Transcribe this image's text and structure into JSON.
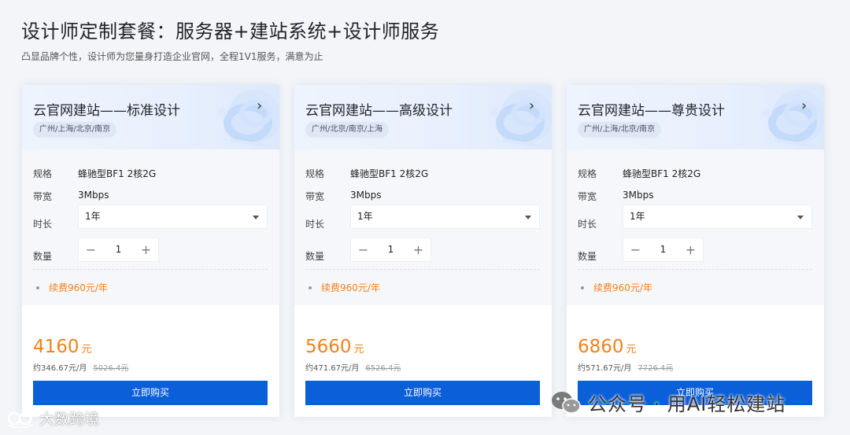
{
  "header": {
    "title": "设计师定制套餐：服务器+建站系统+设计师服务",
    "subtitle": "凸显品牌个性，设计师为您量身打造企业官网，全程1V1服务，满意为止"
  },
  "labels": {
    "spec": "规格",
    "bandwidth": "带宽",
    "duration": "时长",
    "quantity": "数量",
    "minus": "−",
    "plus": "+",
    "price_unit": "元",
    "buy": "立即购买"
  },
  "cards": [
    {
      "title": "云官网建站——标准设计",
      "regions": "广州/上海/北京/南京",
      "spec": "蜂驰型BF1 2核2G",
      "bandwidth": "3Mbps",
      "duration": "1年",
      "quantity": "1",
      "renew": "续费960元/年",
      "price": "4160",
      "monthly": "约346.67元/月",
      "original": "5026.4元"
    },
    {
      "title": "云官网建站——高级设计",
      "regions": "广州/北京/南京/上海",
      "spec": "蜂驰型BF1 2核2G",
      "bandwidth": "3Mbps",
      "duration": "1年",
      "quantity": "1",
      "renew": "续费960元/年",
      "price": "5660",
      "monthly": "约471.67元/月",
      "original": "6526.4元"
    },
    {
      "title": "云官网建站——尊贵设计",
      "regions": "广州/上海/北京/南京",
      "spec": "蜂驰型BF1 2核2G",
      "bandwidth": "3Mbps",
      "duration": "1年",
      "quantity": "1",
      "renew": "续费960元/年",
      "price": "6860",
      "monthly": "约571.67元/月",
      "original": "7726.4元"
    }
  ],
  "watermarks": {
    "left": "大数跨境",
    "right": "公众号 · 用AI轻松建站"
  },
  "icons": {
    "chevron": "chevron-right-icon",
    "caret": "caret-down-icon",
    "wechat": "wechat-icon"
  },
  "colors": {
    "accent": "#0b5fd9",
    "price": "#f0821e",
    "header_bg": "#e8f0fd"
  }
}
